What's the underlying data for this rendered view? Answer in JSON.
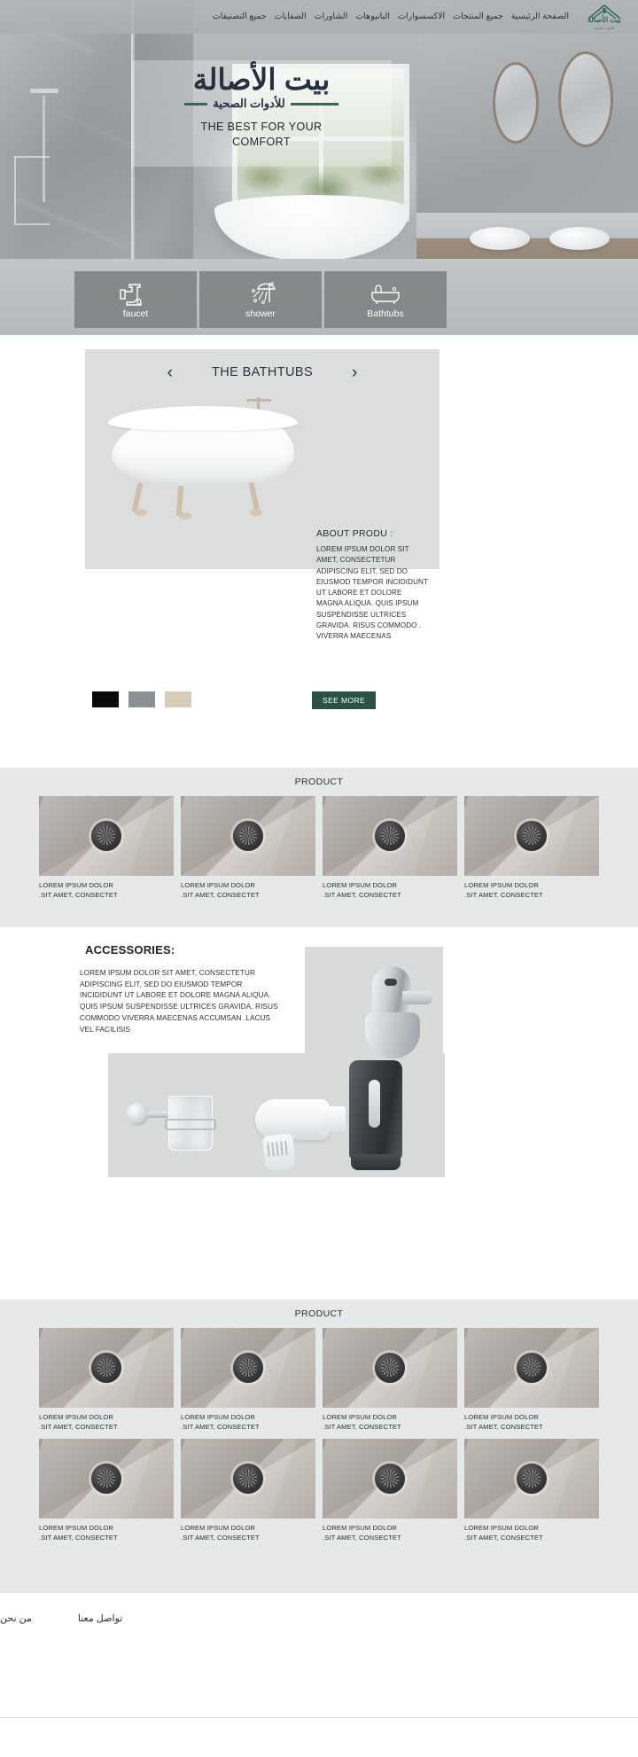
{
  "nav": {
    "links": [
      "الصفحة الرئيسية",
      "جميع المنتجات",
      "الاكسسوارات",
      "البانيوهات",
      "الشاورات",
      "الصفايات",
      "جميع التصنيفات"
    ],
    "logo_word": "بيت الأصالة",
    "logo_sub": "للأدوات الصحية"
  },
  "hero": {
    "brand_ar": "بيت الأصالة",
    "brand_ar_sub": "للأدوات الصحية",
    "brand_en_line1": "THE BEST FOR YOUR",
    "brand_en_line2": "COMFORT"
  },
  "categories": [
    {
      "label": "faucet",
      "icon": "faucet-icon"
    },
    {
      "label": "shower",
      "icon": "shower-icon"
    },
    {
      "label": "Bathtubs",
      "icon": "bathtub-icon"
    }
  ],
  "showcase": {
    "prev": "‹",
    "next": "›",
    "title": "THE BATHTUBS",
    "about_title": "ABOUT  PRODU :",
    "about_body": "LOREM IPSUM DOLOR SIT AMET, CONSECTETUR ADIPISCING ELIT, SED DO EIUSMOD TEMPOR INCIDIDUNT UT LABORE ET DOLORE MAGNA ALIQUA. QUIS IPSUM SUSPENDISSE ULTRICES GRAVIDA. RISUS COMMODO . VIVERRA MAECENAS",
    "see_more": "SEE MORE",
    "swatches": [
      "#0a0a0a",
      "#8d9093",
      "#d9cbba"
    ]
  },
  "product_band_1": {
    "title": "PRODUCT",
    "caption_line1": "LOREM IPSUM DOLOR",
    "caption_line2": ".SIT AMET, CONSECTET",
    "cards": [
      {
        "caption_line1": "LOREM IPSUM DOLOR",
        "caption_line2": ".SIT AMET, CONSECTET"
      },
      {
        "caption_line1": "LOREM IPSUM DOLOR",
        "caption_line2": ".SIT AMET, CONSECTET"
      },
      {
        "caption_line1": "LOREM IPSUM DOLOR",
        "caption_line2": ".SIT AMET, CONSECTET"
      },
      {
        "caption_line1": "LOREM IPSUM DOLOR",
        "caption_line2": ".SIT AMET, CONSECTET"
      }
    ]
  },
  "accessories": {
    "title": "ACCESSORIES:",
    "body": "LOREM IPSUM DOLOR SIT AMET, CONSECTETUR ADIPISCING ELIT, SED DO EIUSMOD TEMPOR INCIDIDUNT UT LABORE ET DOLORE MAGNA ALIQUA. QUIS IPSUM SUSPENDISSE ULTRICES GRAVIDA. RISUS COMMODO VIVERRA MAECENAS ACCUMSAN .LACUS VEL FACILISIS"
  },
  "product_band_2": {
    "title": "PRODUCT",
    "cards": [
      {
        "caption_line1": "LOREM IPSUM DOLOR",
        "caption_line2": ".SIT AMET, CONSECTET"
      },
      {
        "caption_line1": "LOREM IPSUM DOLOR",
        "caption_line2": ".SIT AMET, CONSECTET"
      },
      {
        "caption_line1": "LOREM IPSUM DOLOR",
        "caption_line2": ".SIT AMET, CONSECTET"
      },
      {
        "caption_line1": "LOREM IPSUM DOLOR",
        "caption_line2": ".SIT AMET, CONSECTET"
      },
      {
        "caption_line1": "LOREM IPSUM DOLOR",
        "caption_line2": ".SIT AMET, CONSECTET"
      },
      {
        "caption_line1": "LOREM IPSUM DOLOR",
        "caption_line2": ".SIT AMET, CONSECTET"
      },
      {
        "caption_line1": "LOREM IPSUM DOLOR",
        "caption_line2": ".SIT AMET, CONSECTET"
      },
      {
        "caption_line1": "LOREM IPSUM DOLOR",
        "caption_line2": ".SIT AMET, CONSECTET"
      }
    ]
  },
  "footer": {
    "links": [
      "من نحن",
      "تواصل معنا"
    ]
  },
  "colors": {
    "accent_green": "#2c5244",
    "band_bg": "#e7e8e8",
    "panel_gray": "#d9dada",
    "text_dark": "#2b3038"
  }
}
